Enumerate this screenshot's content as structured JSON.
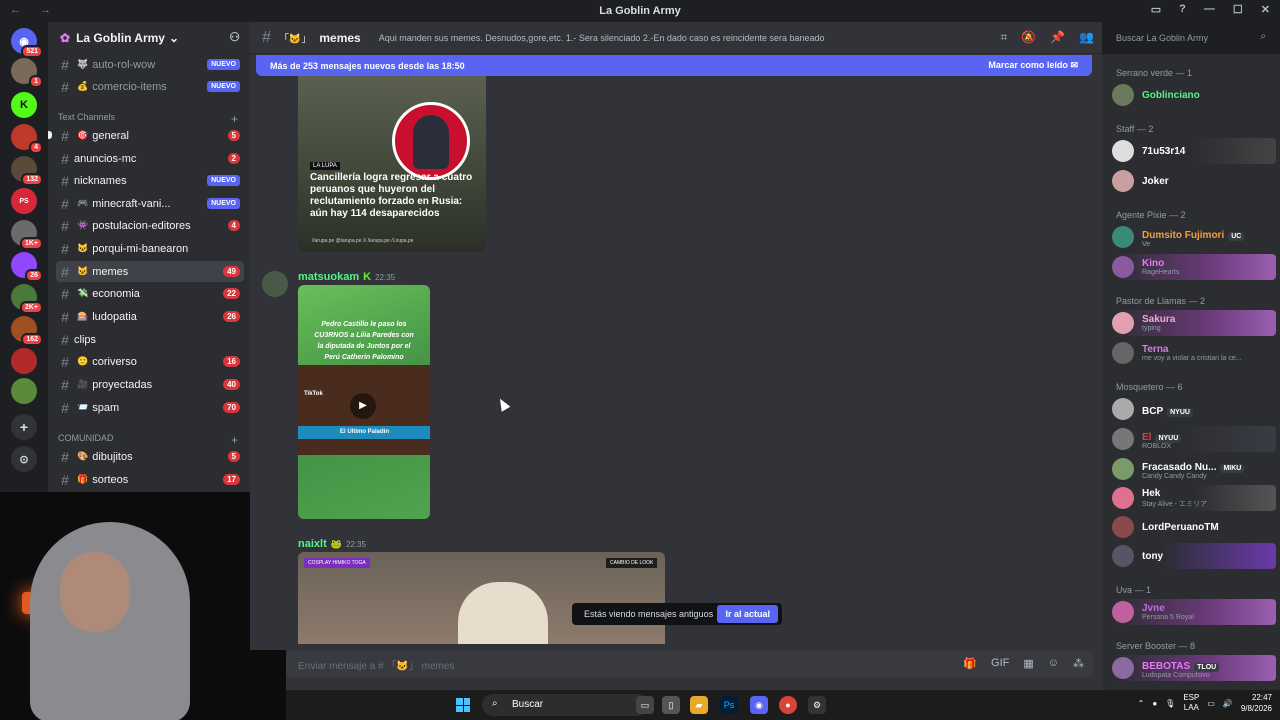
{
  "window": {
    "title": "La Goblin Army"
  },
  "rail": {
    "top_badge": "521",
    "servers": [
      {
        "badge": "1",
        "color": "#7a6a5a"
      },
      {
        "badge": "",
        "color": "#53fc18",
        "label": "K"
      },
      {
        "badge": "4",
        "color": "#c0392b"
      },
      {
        "badge": "132",
        "color": "#5a4a3a"
      },
      {
        "badge": "",
        "color": "#d62839",
        "label": "PS"
      },
      {
        "badge": "1K+",
        "color": "#6b6b6b"
      },
      {
        "badge": "26",
        "color": "#9146ff"
      },
      {
        "badge": "2K+",
        "color": "#4a7a3a"
      },
      {
        "badge": "162",
        "color": "#a05020"
      },
      {
        "badge": "",
        "color": "#b22a2a"
      },
      {
        "badge": "",
        "color": "#5a8a3a"
      }
    ]
  },
  "server": {
    "name": "La Goblin Army"
  },
  "sidebar": {
    "top_channels": [
      {
        "name": "auto-rol-wow",
        "badge_new": "NUEVO"
      },
      {
        "name": "comercio-items",
        "badge_new": "NUEVO"
      }
    ],
    "category_text": "Text Channels",
    "text_channels": [
      {
        "name": "general",
        "count": "5"
      },
      {
        "name": "anuncios-mc",
        "count": "2"
      },
      {
        "name": "nicknames",
        "new": "NUEVO"
      },
      {
        "name": "minecraft-vani...",
        "new": "NUEVO"
      },
      {
        "name": "postulacion-editores",
        "count": "4"
      },
      {
        "name": "porqui-mi-banearon",
        "count": ""
      },
      {
        "name": "memes",
        "count": "49"
      },
      {
        "name": "economia",
        "count": "22"
      },
      {
        "name": "ludopatia",
        "count": "26"
      },
      {
        "name": "clips",
        "count": ""
      },
      {
        "name": "coriverso",
        "count": "16"
      },
      {
        "name": "proyectadas",
        "count": "40"
      },
      {
        "name": "spam",
        "count": "70"
      }
    ],
    "category_comunidad": "COMUNIDAD",
    "comunidad_channels": [
      {
        "name": "dibujitos",
        "count": "5"
      },
      {
        "name": "sorteos",
        "count": "17"
      }
    ]
  },
  "chat": {
    "channel": "memes",
    "topic": "Aqui manden sus memes. Desnudos,gore,etc. 1.- Sera silenciado 2.-En dado caso es reincidente sera baneado",
    "new_messages": "Más de 253 mensajes nuevos desde las 18:50",
    "mark_read": "Marcar como leído",
    "search_placeholder": "Buscar La Goblin Army",
    "embed1": {
      "tag": "LA LUPA",
      "headline": "Cancillería logra regresar a cuatro peruanos que huyeron del reclutamiento forzado en Rusia: aún hay 114 desaparecidos",
      "footer": "/larupa.pe  @larupa.pe  X /larupa.pe  /Lirupa.pe"
    },
    "msg2": {
      "author": "matsuokam",
      "time": "22:35",
      "caption": "Pedro Castillo le paso los CU3RNOS a Lilia Paredes con la diputada de Juntos por el Perú Catherin Palomino",
      "tiktok": "TikTok",
      "band": "El Ultimo Paladin"
    },
    "msg3": {
      "author": "naixlt",
      "time": "22:35",
      "label_left": "COSPLAY HIMIKO TOGA",
      "label_right": "CAMBIO DE LOOK"
    },
    "old_messages": "Estás viendo mensajes antiguos",
    "jump": "Ir al actual",
    "composer_placeholder": "Enviar mensaje a # 「🐱」 memes"
  },
  "members": {
    "groups": [
      {
        "title": "Serrano verde — 1",
        "items": [
          {
            "name": "Goblinciano",
            "color": "#57f287",
            "sub": ""
          }
        ]
      },
      {
        "title": "Staff — 2",
        "items": [
          {
            "name": "71u53r14",
            "color": "#ffffff",
            "sub": ""
          },
          {
            "name": "Joker",
            "color": "#ffffff",
            "sub": ""
          }
        ]
      },
      {
        "title": "Agente Pixie — 2",
        "items": [
          {
            "name": "Dumsito Fujimori",
            "color": "#f0a23c",
            "sub": "Ve",
            "tag": "UC"
          },
          {
            "name": "Kino",
            "color": "#e879f9",
            "sub": "RageHearts"
          }
        ]
      },
      {
        "title": "Pastor de Llamas — 2",
        "items": [
          {
            "name": "Sakura",
            "color": "#f5a8d0",
            "sub": "typing"
          },
          {
            "name": "Terna",
            "color": "#d080e0",
            "sub": "me voy a violar a cristian la ce..."
          }
        ]
      },
      {
        "title": "Mosquetero — 6",
        "items": [
          {
            "name": "BCP",
            "color": "#ffffff",
            "sub": "",
            "tag": "NYUU"
          },
          {
            "name": "El",
            "color": "#e04040",
            "sub": "ROBLOX",
            "tag": "NYUU"
          },
          {
            "name": "Fracasado Nu...",
            "color": "#ffffff",
            "sub": "Candy Candy Candy",
            "tag": "MIKU"
          },
          {
            "name": "Hek",
            "color": "#ffffff",
            "sub": "Stay Alive - エミリア"
          },
          {
            "name": "LordPeruanoTM",
            "color": "#ffffff",
            "sub": ""
          },
          {
            "name": "tony",
            "color": "#ffffff",
            "sub": ""
          }
        ]
      },
      {
        "title": "Uva — 1",
        "items": [
          {
            "name": "Jvne",
            "color": "#c070e0",
            "sub": "Persona 5 Royal"
          }
        ]
      },
      {
        "title": "Server Booster — 8",
        "items": [
          {
            "name": "BEBOTAS",
            "color": "#e879f9",
            "sub": "Ludopata Compulsivo",
            "tag": "TLOU"
          }
        ]
      }
    ]
  },
  "taskbar": {
    "search": "Buscar",
    "lang": "ESP",
    "layout": "LAA",
    "time": "22:47",
    "date": "9/8/2026"
  }
}
